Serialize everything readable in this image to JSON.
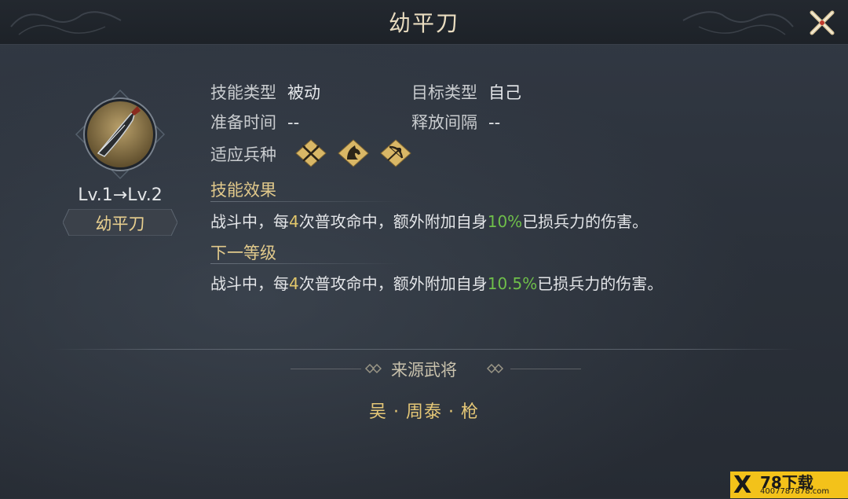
{
  "window": {
    "title": "幼平刀"
  },
  "skill": {
    "level_text": "Lv.1→Lv.2",
    "name": "幼平刀"
  },
  "attributes": {
    "skill_type_label": "技能类型",
    "skill_type_value": "被动",
    "target_type_label": "目标类型",
    "target_type_value": "自己",
    "prep_time_label": "准备时间",
    "prep_time_value": "--",
    "cast_interval_label": "释放间隔",
    "cast_interval_value": "--",
    "troops_label": "适应兵种",
    "troops": [
      "crossed-spears-icon",
      "horse-head-icon",
      "bow-icon"
    ]
  },
  "effect": {
    "title": "技能效果",
    "text_a": "战斗中，每",
    "num_a": "4",
    "text_b": "次普攻命中，额外附加自身",
    "num_b": "10%",
    "text_c": "已损兵力的伤害。"
  },
  "next_level": {
    "title": "下一等级",
    "text_a": "战斗中，每",
    "num_a": "4",
    "text_b": "次普攻命中，额外附加自身",
    "num_b": "10.5%",
    "text_c": "已损兵力的伤害。"
  },
  "source": {
    "title": "来源武将",
    "general": "吴 · 周泰 · 枪"
  },
  "watermark": {
    "main": "78下载",
    "sub": "4007787878.com"
  },
  "colors": {
    "gold": "#e1c98b",
    "green_highlight": "#6fbf4a",
    "yellow_number": "#e2c76b"
  }
}
